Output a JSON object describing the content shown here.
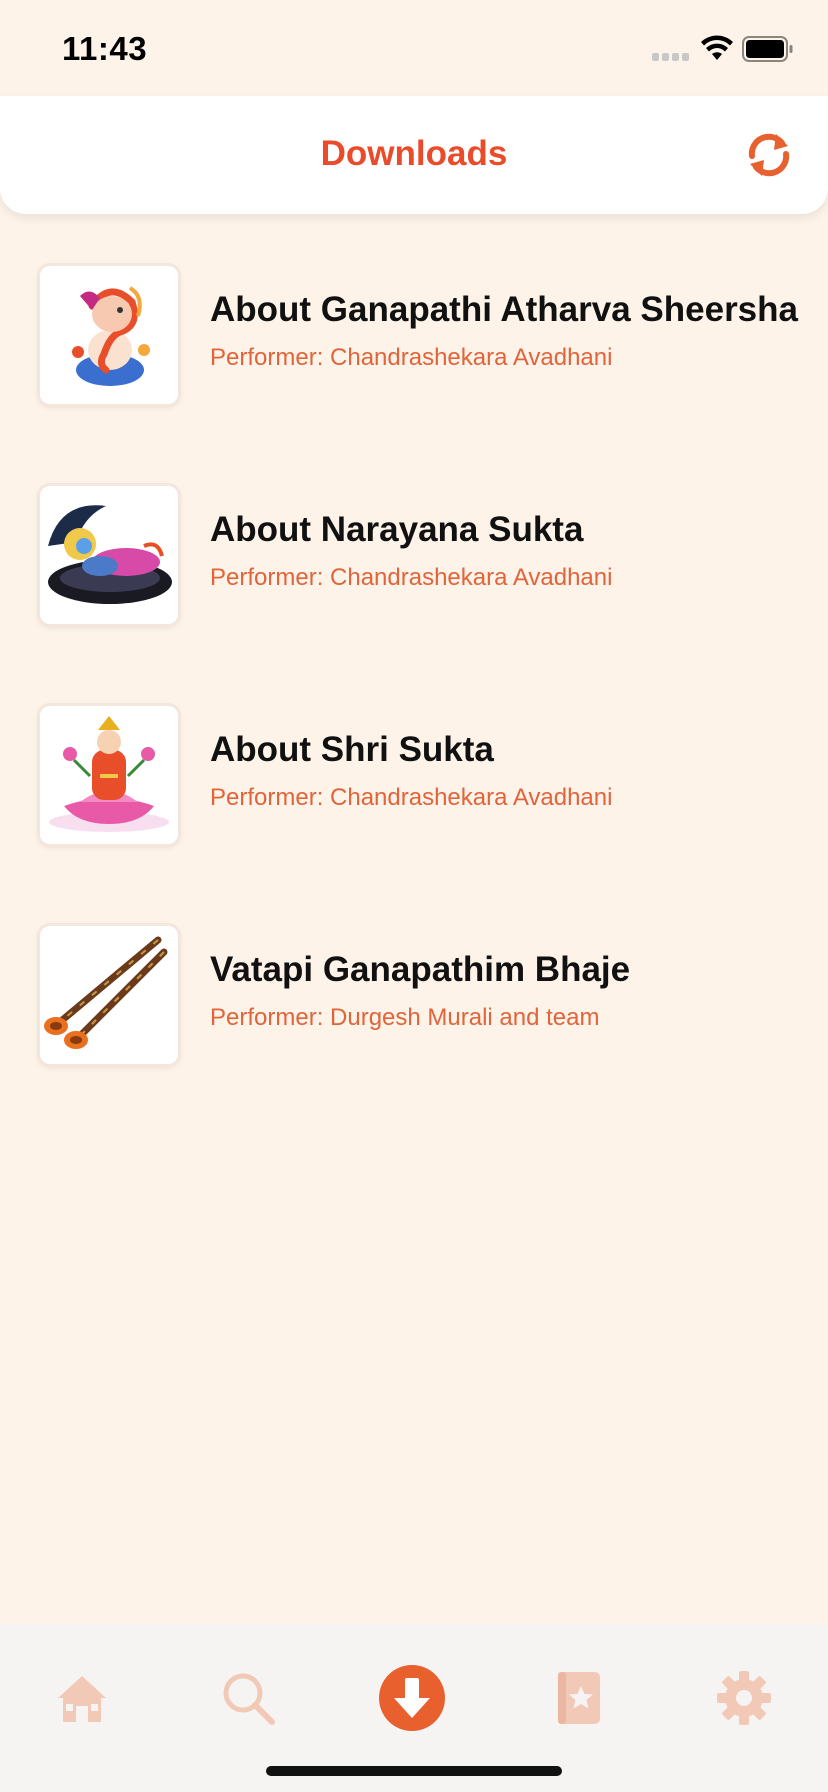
{
  "status_bar": {
    "time": "11:43",
    "signal_icon": "signal-dots-icon",
    "wifi_icon": "wifi-icon",
    "battery_icon": "battery-icon"
  },
  "header": {
    "title": "Downloads",
    "refresh_icon": "refresh-icon"
  },
  "downloads": [
    {
      "title": "About Ganapathi Atharva Sheersha",
      "performer": "Performer: Chandrashekara Avadhani",
      "thumbnail_icon": "ganapathi-image"
    },
    {
      "title": "About Narayana Sukta",
      "performer": "Performer: Chandrashekara Avadhani",
      "thumbnail_icon": "narayana-image"
    },
    {
      "title": "About Shri Sukta",
      "performer": "Performer: Chandrashekara Avadhani",
      "thumbnail_icon": "lakshmi-image"
    },
    {
      "title": "Vatapi Ganapathim Bhaje",
      "performer": "Performer: Durgesh Murali and team",
      "thumbnail_icon": "nadaswaram-image"
    }
  ],
  "tab_bar": {
    "tabs": [
      {
        "icon": "home-icon",
        "active": false
      },
      {
        "icon": "search-icon",
        "active": false
      },
      {
        "icon": "download-icon",
        "active": true
      },
      {
        "icon": "favorites-book-icon",
        "active": false
      },
      {
        "icon": "settings-gear-icon",
        "active": false
      }
    ]
  },
  "colors": {
    "accent": "#e94b2b",
    "performer_text": "#e1643a",
    "background": "#fdf3e8",
    "inactive_tab_icon": "#f2c9b6"
  }
}
